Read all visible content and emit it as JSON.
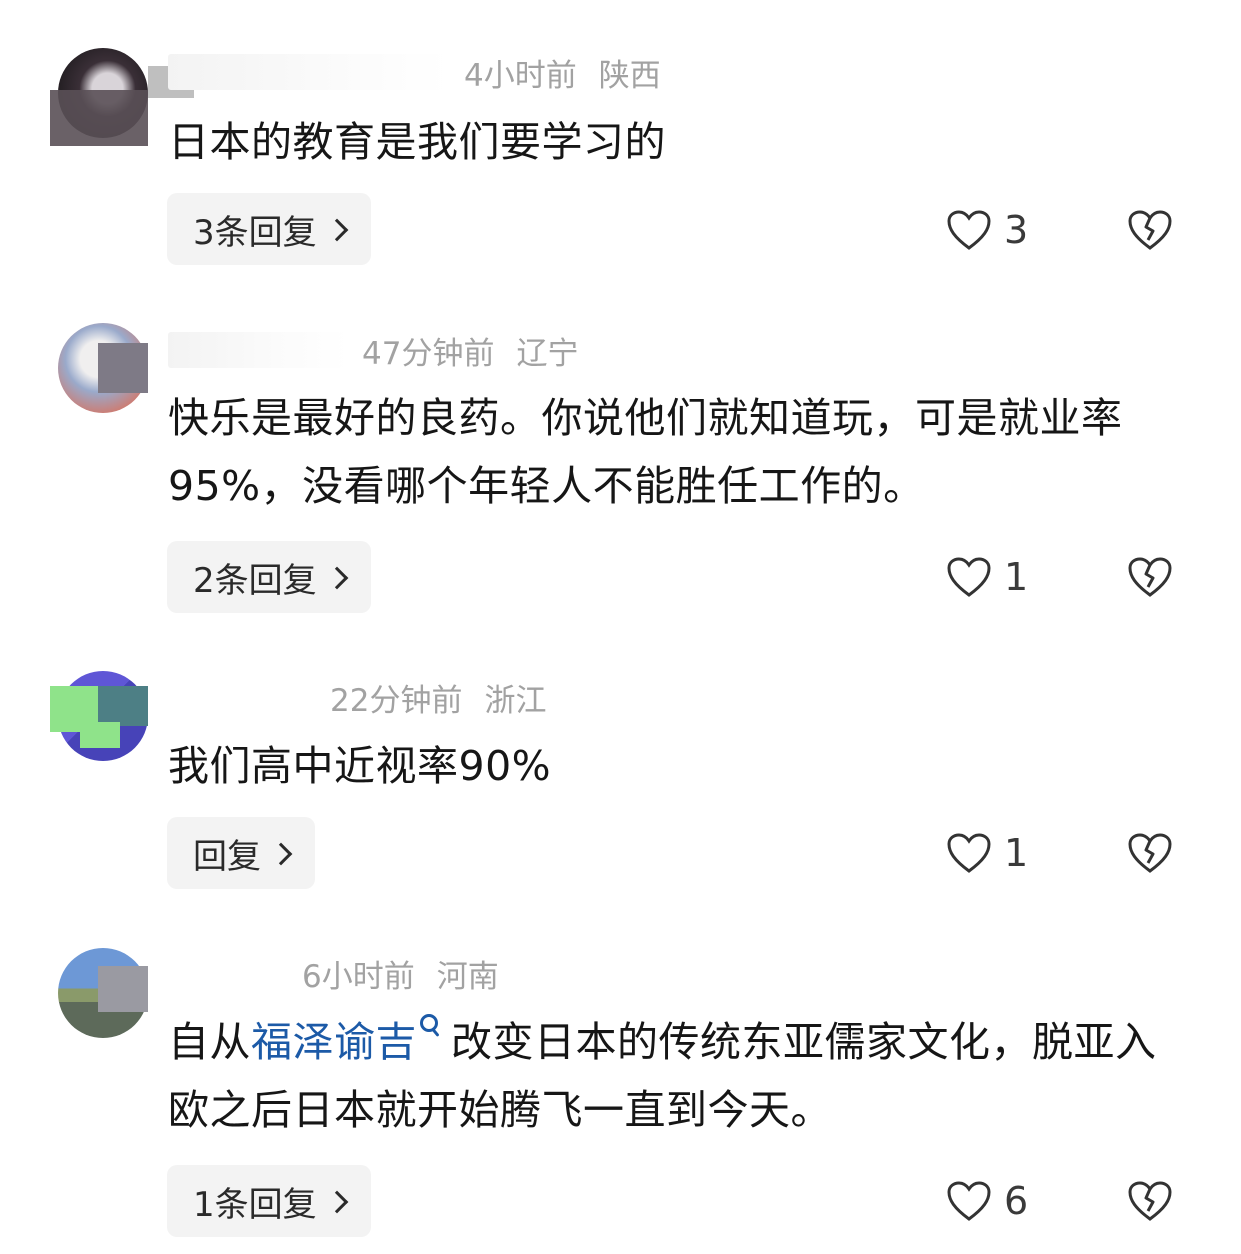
{
  "comments": [
    {
      "time": "4小时前",
      "location": "陕西",
      "body": "日本的教育是我们要学习的",
      "reply_label": "3条回复",
      "likes": "3"
    },
    {
      "time": "47分钟前",
      "location": "辽宁",
      "body": "快乐是最好的良药。你说他们就知道玩，可是就业率95%，没看哪个年轻人不能胜任工作的。",
      "reply_label": "2条回复",
      "likes": "1"
    },
    {
      "time": "22分钟前",
      "location": "浙江",
      "body": "我们高中近视率90%",
      "reply_label": "回复",
      "likes": "1"
    },
    {
      "time": "6小时前",
      "location": "河南",
      "body_before": "自从",
      "body_link": "福泽谕吉",
      "body_after": "改变日本的传统东亚儒家文化，脱亚入欧之后日本就开始腾飞一直到今天。",
      "reply_label": "1条回复",
      "likes": "6"
    }
  ],
  "icons": {
    "like": "heart-outline-icon",
    "dislike": "broken-heart-icon",
    "link_search": "search-icon",
    "reply_arrow": "chevron-right-icon"
  },
  "colors": {
    "meta_text": "#a2a2a2",
    "link": "#1c5aa7",
    "button_bg": "#f3f3f3"
  }
}
